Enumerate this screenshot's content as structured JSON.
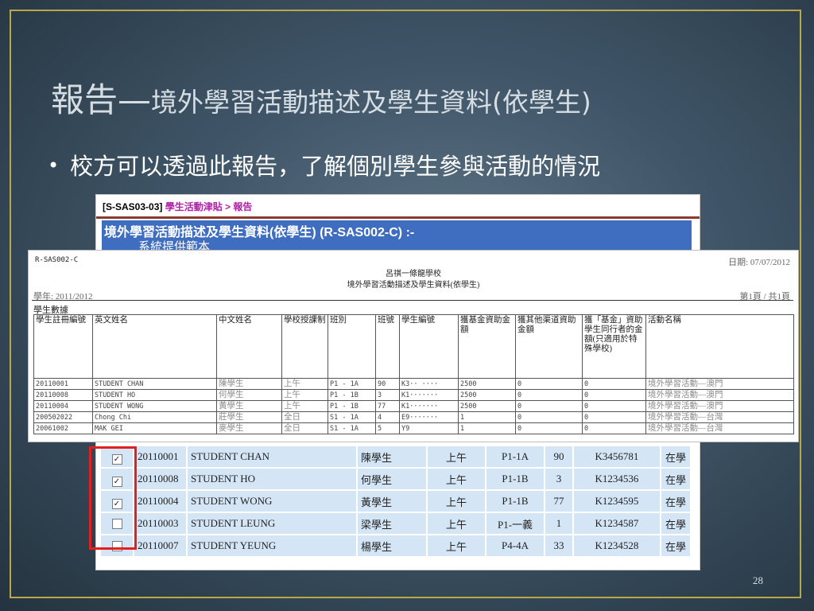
{
  "slide": {
    "title_big": "報告—",
    "title_small": "境外學習活動描述及學生資料(依學生)",
    "bullet": "校方可以透過此報告，了解個別學生參與活動的情況",
    "bullet_dot": "•",
    "page_number": "28"
  },
  "app": {
    "breadcrumb_code": "[S-SAS03-03]",
    "breadcrumb_link": "學生活動津貼 > 報告",
    "header_title": "境外學習活動描述及學生資料(依學生) (R-SAS002-C) :-",
    "header_sub": "系統提供範本",
    "rows": [
      {
        "checked": true,
        "mark": "✓",
        "reg": "20110001",
        "eng": "STUDENT  CHAN",
        "chi": "陳學生",
        "session": "上午",
        "class": "P1-1A",
        "no": "90",
        "id": "K3456781",
        "status": "在學"
      },
      {
        "checked": true,
        "mark": "✓",
        "reg": "20110008",
        "eng": "STUDENT  HO",
        "chi": "何學生",
        "session": "上午",
        "class": "P1-1B",
        "no": "3",
        "id": "K1234536",
        "status": "在學"
      },
      {
        "checked": true,
        "mark": "✓",
        "reg": "20110004",
        "eng": "STUDENT  WONG",
        "chi": "黃學生",
        "session": "上午",
        "class": "P1-1B",
        "no": "77",
        "id": "K1234595",
        "status": "在學"
      },
      {
        "checked": false,
        "mark": "",
        "reg": "20110003",
        "eng": "STUDENT  LEUNG",
        "chi": "梁學生",
        "session": "上午",
        "class": "P1-一義",
        "no": "1",
        "id": "K1234587",
        "status": "在學"
      },
      {
        "checked": false,
        "mark": "",
        "reg": "20110007",
        "eng": "STUDENT  YEUNG",
        "chi": "楊學生",
        "session": "上午",
        "class": "P4-4A",
        "no": "33",
        "id": "K1234528",
        "status": "在學"
      }
    ]
  },
  "report": {
    "code": "R-SAS002-C",
    "date": "日期: 07/07/2012",
    "school": "呂祺一條龍學校",
    "subtitle": "境外學習活動描述及學生資料(依學生)",
    "year": "學年: 2011/2012",
    "page": "第1頁 / 共1頁",
    "section": "學生數據",
    "headers": [
      "學生註冊編號",
      "英文姓名",
      "中文姓名",
      "學校授課制",
      "班別",
      "班號",
      "學生編號",
      "獲基金資助金額",
      "獲其他渠道資助金額",
      "獲「基金」資助學生同行者的金額(只適用於特殊學校)",
      "活動名稱"
    ],
    "rows": [
      [
        "20110001",
        "STUDENT CHAN",
        "陳學生",
        "上午",
        "P1 - 1A",
        "90",
        "K3·· ····",
        "2500",
        "0",
        "0",
        "境外學習活動—澳門"
      ],
      [
        "20110008",
        "STUDENT HO",
        "何學生",
        "上午",
        "P1 - 1B",
        "3",
        "K1·······",
        "2500",
        "0",
        "0",
        "境外學習活動—澳門"
      ],
      [
        "20110004",
        "STUDENT WONG",
        "黃學生",
        "上午",
        "P1 - 1B",
        "77",
        "K1·······",
        "2500",
        "0",
        "0",
        "境外學習活動—澳門"
      ],
      [
        "200502022",
        "Chong Chi",
        "莊學生",
        "全日",
        "S1 - 1A",
        "4",
        "E9·······",
        "1",
        "0",
        "0",
        "境外學習活動—台灣"
      ],
      [
        "20061002",
        "MAK GEI",
        "麥學生",
        "全日",
        "S1 - 1A",
        "5",
        "Y9",
        "1",
        "0",
        "0",
        "境外學習活動—台灣"
      ]
    ]
  }
}
